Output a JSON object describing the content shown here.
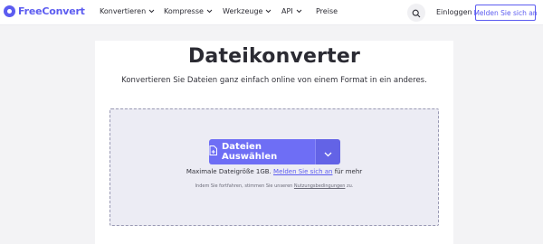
{
  "brand": {
    "name_part1": "Free",
    "name_part2": "Convert",
    "logo_icon": "freeconvert-logo",
    "accent": "#5c5cf0"
  },
  "nav": {
    "items": [
      {
        "label": "Konvertieren",
        "has_dropdown": true
      },
      {
        "label": "Kompresse",
        "has_dropdown": true
      },
      {
        "label": "Werkzeuge",
        "has_dropdown": true
      },
      {
        "label": "API",
        "has_dropdown": true
      },
      {
        "label": "Preise",
        "has_dropdown": false
      }
    ],
    "search_icon": "search-icon",
    "login_label": "Einloggen",
    "signup_label": "Melden Sie sich an"
  },
  "main": {
    "title": "Dateikonverter",
    "subtitle": "Konvertieren Sie Dateien ganz einfach online von einem Format in ein anderes.",
    "upload_button_label": "Dateien Auswählen",
    "upload_icon": "file-plus-icon",
    "dropdown_icon": "chevron-down-icon",
    "max_size_prefix": "Maximale Dateigröße 1GB.",
    "max_size_link": "Melden Sie sich an",
    "max_size_suffix": "für mehr",
    "terms_prefix": "Indem Sie fortfahren, stimmen Sie unseren",
    "terms_link": "Nutzungsbedingungen",
    "terms_suffix": "zu."
  },
  "colors": {
    "primary_button": "#6e6ef5",
    "dropzone_bg": "#ececf4",
    "page_bg": "#f3f3f5"
  }
}
